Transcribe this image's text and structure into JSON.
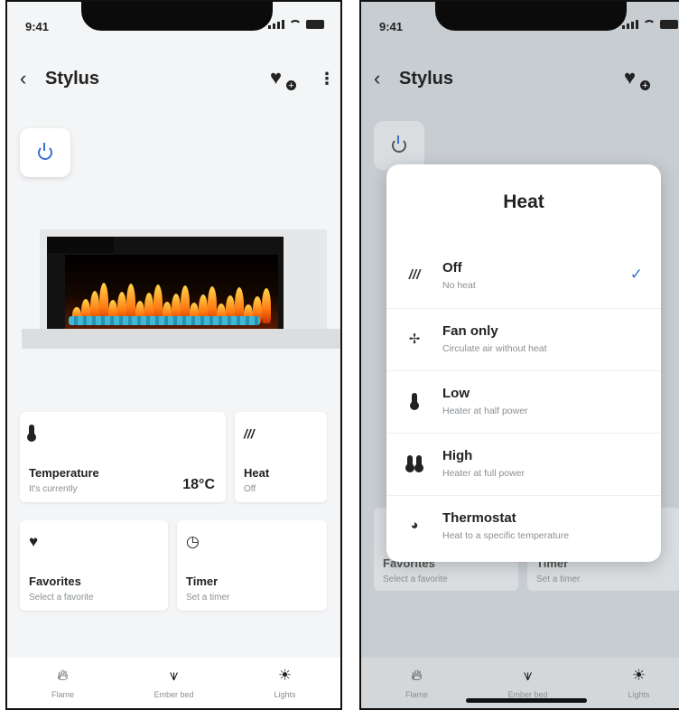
{
  "status": {
    "time": "9:41"
  },
  "header": {
    "title": "Stylus",
    "back_icon": "chevron-left-icon",
    "favorite_icon": "heart-plus-icon",
    "menu_icon": "kebab-icon"
  },
  "controls": {
    "temperature": {
      "label": "Temperature",
      "sub": "It's currently",
      "value": "18°C"
    },
    "heat": {
      "label": "Heat",
      "sub": "Off"
    },
    "favorites": {
      "label": "Favorites",
      "sub": "Select a favorite"
    },
    "timer": {
      "label": "Timer",
      "sub": "Set a timer"
    }
  },
  "nav": [
    {
      "label": "Flame",
      "icon": "flame-icon"
    },
    {
      "label": "Ember bed",
      "icon": "ember-bed-icon"
    },
    {
      "label": "Lights",
      "icon": "sun-icon"
    }
  ],
  "heat_modal": {
    "title": "Heat",
    "options": [
      {
        "name": "Off",
        "desc": "No heat",
        "icon": "heat-waves-icon",
        "selected": true
      },
      {
        "name": "Fan only",
        "desc": "Circulate air without heat",
        "icon": "fan-icon",
        "selected": false
      },
      {
        "name": "Low",
        "desc": "Heater at half power",
        "icon": "thermometer-icon",
        "selected": false
      },
      {
        "name": "High",
        "desc": "Heater at full power",
        "icon": "double-thermometer-icon",
        "selected": false
      },
      {
        "name": "Thermostat",
        "desc": "Heat to a specific temperature",
        "icon": "thermostat-icon",
        "selected": false
      }
    ]
  },
  "colors": {
    "accent": "#3a6fd6",
    "background": "#f4f5f6",
    "dimmed": "#c8cdd2"
  }
}
